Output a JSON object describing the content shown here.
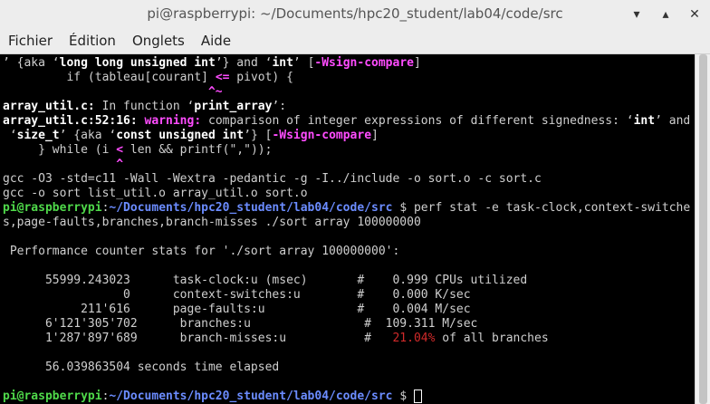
{
  "window": {
    "title": "pi@raspberrypi: ~/Documents/hpc20_student/lab04/code/src"
  },
  "menu": [
    "Fichier",
    "Édition",
    "Onglets",
    "Aide"
  ],
  "prompt": {
    "user": "pi@raspberrypi",
    "path": "~/Documents/hpc20_student/lab04/code/src",
    "symbol": "$"
  },
  "lines": {
    "l1": {
      "a": "’ {aka ‘",
      "b": "long long unsigned int",
      "c": "’} and ‘",
      "d": "int",
      "e": "’ [",
      "f": "-Wsign-compare",
      "g": "]"
    },
    "l2": {
      "a": "         if (tableau[courant] ",
      "b": "<=",
      "c": " pivot) {"
    },
    "l3": {
      "a": "                             ",
      "b": "^~"
    },
    "l4": {
      "a": "array_util.c:",
      "b": " In function ‘",
      "c": "print_array",
      "d": "’:"
    },
    "l5": {
      "a": "array_util.c:52:16:",
      "b": " ",
      "c": "warning:",
      "d": " comparison of integer expressions of different signedness: ‘",
      "e": "int",
      "f": "’ and"
    },
    "l6": {
      "a": " ‘",
      "b": "size_t",
      "c": "’ {aka ‘",
      "d": "const unsigned int",
      "e": "’} [",
      "f": "-Wsign-compare",
      "g": "]"
    },
    "l7": {
      "a": "     } while (i ",
      "b": "<",
      "c": " len && printf(\",\"));"
    },
    "l8": {
      "a": "                ",
      "b": "^"
    },
    "l9": "gcc -O3 -std=c11 -Wall -Wextra -pedantic -g -I../include -o sort.o -c sort.c",
    "l10": "gcc -o sort list_util.o array_util.o sort.o",
    "l11": " perf stat -e task-clock,context-switche",
    "l12": "s,page-faults,branches,branch-misses ./sort array 100000000",
    "l13": " Performance counter stats for './sort array 100000000':",
    "stats": [
      {
        "a": "      55999.243023      task-clock:u (msec)       #    0.999 CPUs utilized"
      },
      {
        "a": "                 0      context-switches:u        #    0.000 K/sec"
      },
      {
        "a": "           211'616      page-faults:u             #    0.004 M/sec"
      },
      {
        "a": "      6'121'305'702      branches:u                #  109.311 M/sec"
      },
      {
        "a": "      1'287'897'689      branch-misses:u           #   ",
        "b": "21.04%",
        "c": " of all branches"
      }
    ],
    "elapsed": "      56.039863504 seconds time elapsed"
  },
  "colors": {
    "prompt_user": "#4fd94a",
    "prompt_path": "#6b8cff",
    "warning": "#ff4cff",
    "miss_rate": "#d12a2a"
  }
}
